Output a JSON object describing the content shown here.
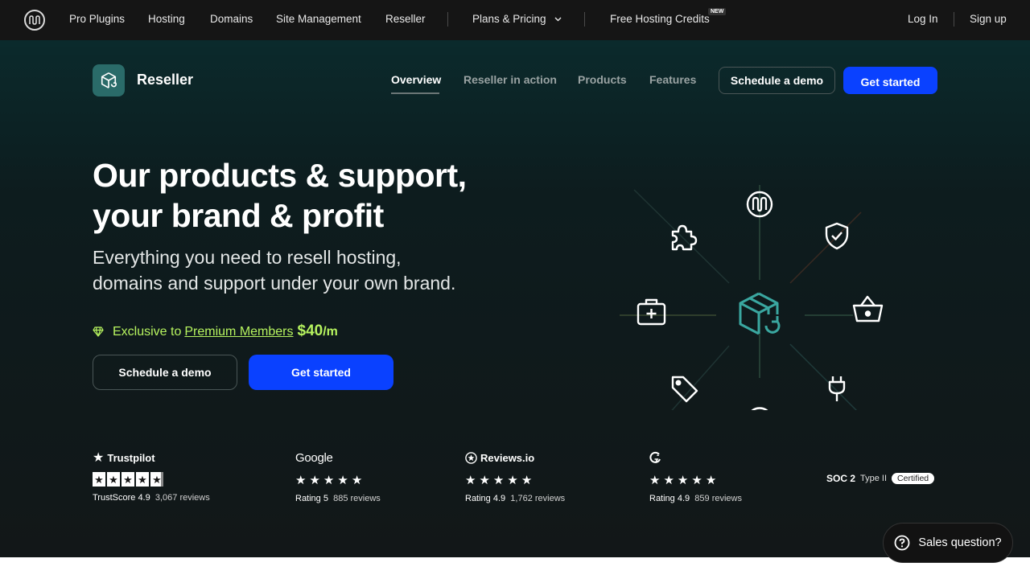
{
  "topnav": {
    "items": [
      "Pro Plugins",
      "Hosting",
      "Domains",
      "Site Management",
      "Reseller"
    ],
    "plans_label": "Plans & Pricing",
    "credits_label": "Free Hosting Credits",
    "new_badge": "NEW",
    "login": "Log In",
    "signup": "Sign up"
  },
  "subnav": {
    "title": "Reseller",
    "links": [
      "Overview",
      "Reseller in action",
      "Products",
      "Features"
    ],
    "demo_button": "Schedule a demo",
    "start_button": "Get started"
  },
  "hero": {
    "headline_line1": "Our products & support,",
    "headline_line2": "your brand & profit",
    "subhead_line1": "Everything you need to resell hosting,",
    "subhead_line2": "domains and support under your own brand.",
    "exclusive_prefix": "Exclusive to",
    "exclusive_link": "Premium Members",
    "price": "$40",
    "price_unit": "/m",
    "demo_button": "Schedule a demo",
    "start_button": "Get started"
  },
  "diagram": {
    "center_icon": "box-refresh-icon",
    "satellite_icons": [
      "wpmudev-logo-icon",
      "shield-check-icon",
      "basket-icon",
      "plug-icon",
      "dollar-icon",
      "tag-icon",
      "briefcase-plus-icon",
      "puzzle-icon"
    ],
    "accent_color": "#3aa7a0"
  },
  "ratings": {
    "trustpilot": {
      "brand": "Trustpilot",
      "label": "TrustScore 4.9",
      "reviews": "3,067 reviews",
      "stars": 4.9
    },
    "google": {
      "brand": "Google",
      "label": "Rating 5",
      "reviews": "885 reviews",
      "stars": 5
    },
    "reviewsio": {
      "brand": "Reviews.io",
      "label": "Rating 4.9",
      "reviews": "1,762 reviews",
      "stars": 4.9
    },
    "g2": {
      "label": "Rating 4.9",
      "reviews": "859 reviews",
      "stars": 4.9
    },
    "soc": {
      "name": "SOC 2",
      "type": "Type II",
      "badge": "Certified"
    }
  },
  "chat": {
    "label": "Sales question?"
  },
  "colors": {
    "topnav_bg": "#151515",
    "primary_blue": "#0a41ff",
    "accent_green": "#b6f35f",
    "hero_teal": "#0b2a2c"
  }
}
